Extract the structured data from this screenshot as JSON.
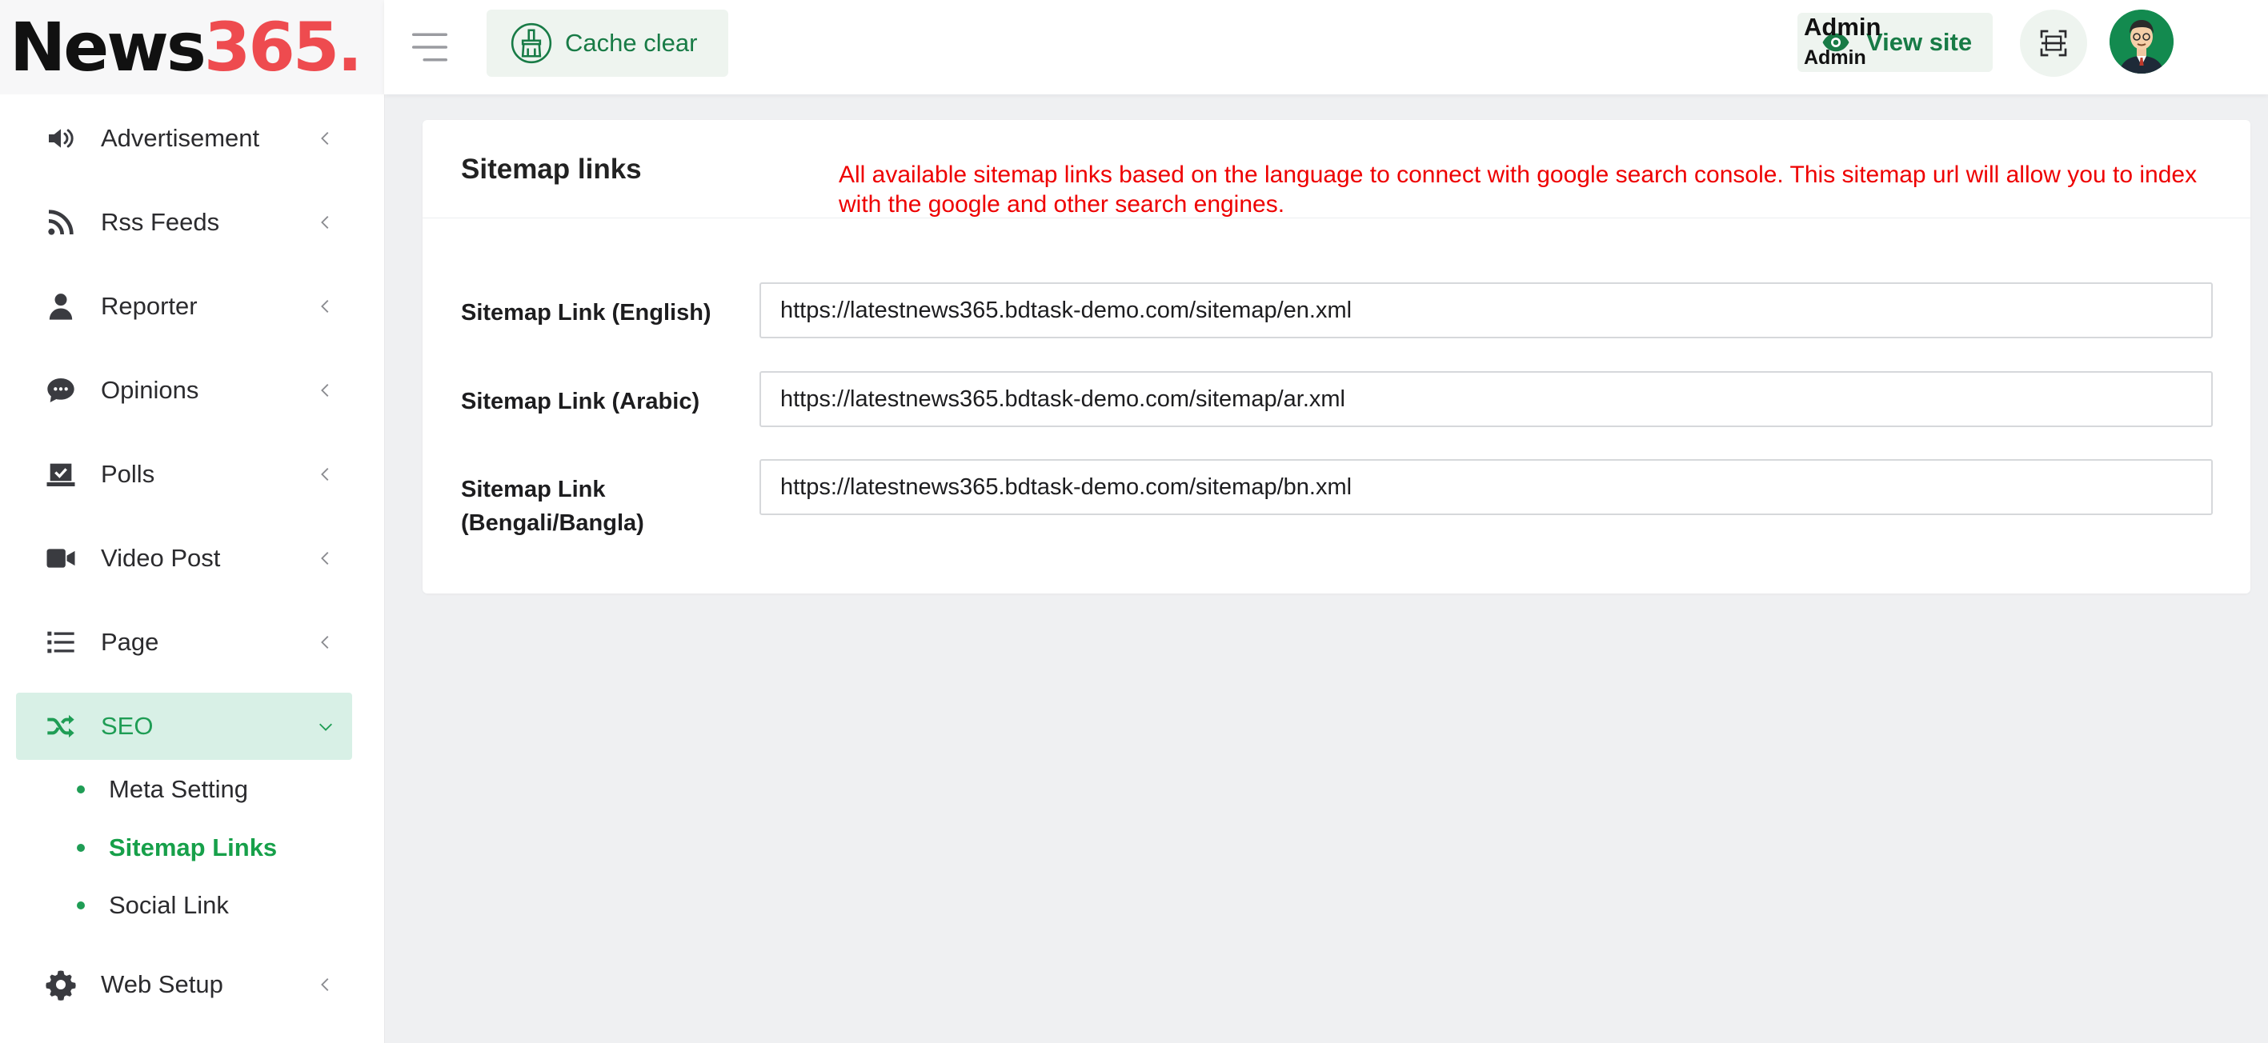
{
  "brand": {
    "name_part1": "News",
    "name_part2": "365.",
    "accent": "#ee4b4f"
  },
  "sidebar": {
    "items": [
      {
        "label": "Advertisement",
        "icon": "speaker-icon"
      },
      {
        "label": "Rss Feeds",
        "icon": "rss-icon"
      },
      {
        "label": "Reporter",
        "icon": "user-icon"
      },
      {
        "label": "Opinions",
        "icon": "comment-icon"
      },
      {
        "label": "Polls",
        "icon": "poll-icon"
      },
      {
        "label": "Video Post",
        "icon": "video-icon"
      },
      {
        "label": "Page",
        "icon": "list-icon"
      },
      {
        "label": "SEO",
        "icon": "shuffle-icon",
        "expanded": true
      },
      {
        "label": "Web Setup",
        "icon": "gear-icon"
      }
    ],
    "seo_subitems": [
      {
        "label": "Meta Setting"
      },
      {
        "label": "Sitemap Links",
        "current": true
      },
      {
        "label": "Social Link"
      }
    ]
  },
  "header": {
    "cache_clear_label": "Cache clear",
    "view_site_label": "View site",
    "user_name": "Admin",
    "user_role": "Admin"
  },
  "card": {
    "title": "Sitemap links",
    "note": "All available sitemap links based on the language to connect with google search console. This sitemap url will allow you to index with the google and other search engines.",
    "fields": [
      {
        "label": "Sitemap Link (English)",
        "value": "https://latestnews365.bdtask-demo.com/sitemap/en.xml"
      },
      {
        "label": "Sitemap Link (Arabic)",
        "value": "https://latestnews365.bdtask-demo.com/sitemap/ar.xml"
      },
      {
        "label": "Sitemap Link (Bengali/Bangla)",
        "value": "https://latestnews365.bdtask-demo.com/sitemap/bn.xml"
      }
    ]
  },
  "colors": {
    "primary_green": "#1f9d55",
    "active_bg": "#d8f0e6",
    "note_red": "#ee0000",
    "page_bg": "#eff0f2"
  }
}
